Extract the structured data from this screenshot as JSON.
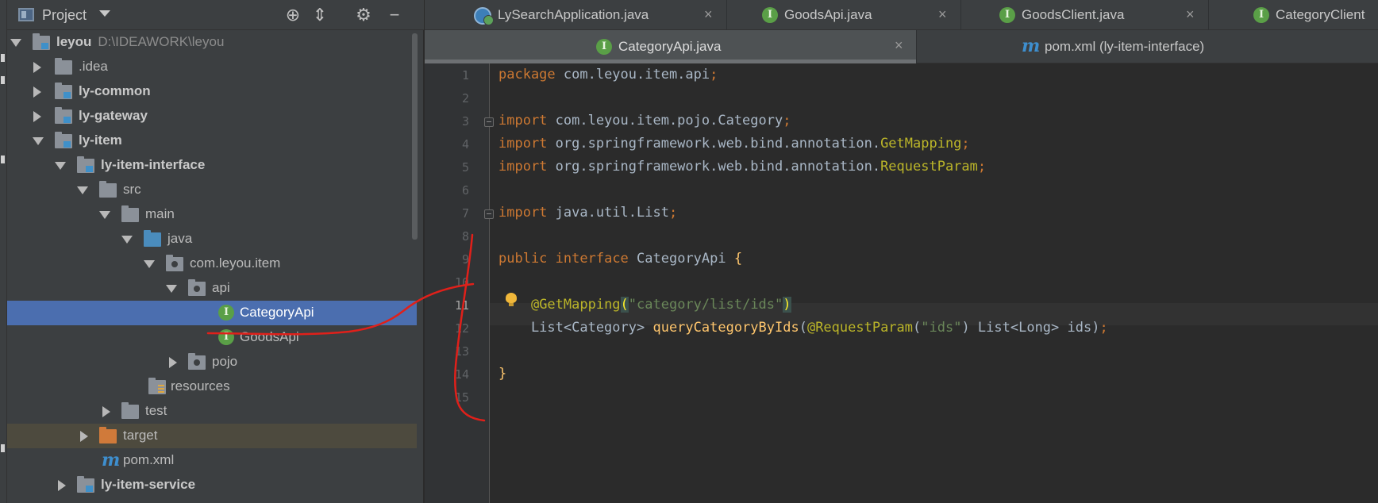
{
  "project_panel": {
    "title": "Project",
    "tree": [
      {
        "label": "leyou",
        "sub": "D:\\IDEAWORK\\leyou",
        "icon": "module-folder-icon",
        "expanded": true
      },
      {
        "label": ".idea",
        "icon": "folder-icon",
        "expanded": false
      },
      {
        "label": "ly-common",
        "icon": "module-folder-icon",
        "expanded": false
      },
      {
        "label": "ly-gateway",
        "icon": "module-folder-icon",
        "expanded": false
      },
      {
        "label": "ly-item",
        "icon": "module-folder-icon",
        "expanded": true
      },
      {
        "label": "ly-item-interface",
        "icon": "module-folder-icon",
        "expanded": true
      },
      {
        "label": "src",
        "icon": "folder-icon",
        "expanded": true
      },
      {
        "label": "main",
        "icon": "folder-icon",
        "expanded": true
      },
      {
        "label": "java",
        "icon": "source-folder-icon",
        "expanded": true
      },
      {
        "label": "com.leyou.item",
        "icon": "package-icon",
        "expanded": true
      },
      {
        "label": "api",
        "icon": "package-icon",
        "expanded": true
      },
      {
        "label": "CategoryApi",
        "icon": "interface-icon",
        "selected": true
      },
      {
        "label": "GoodsApi",
        "icon": "interface-icon"
      },
      {
        "label": "pojo",
        "icon": "package-icon",
        "expanded": false
      },
      {
        "label": "resources",
        "icon": "resources-folder-icon"
      },
      {
        "label": "test",
        "icon": "folder-icon",
        "expanded": false
      },
      {
        "label": "target",
        "icon": "excluded-folder-icon",
        "expanded": false
      },
      {
        "label": "pom.xml",
        "icon": "maven-icon"
      },
      {
        "label": "ly-item-service",
        "icon": "module-folder-icon",
        "expanded": false
      }
    ]
  },
  "tabs_row1": [
    {
      "label": "LySearchApplication.java",
      "icon": "spring-boot-icon"
    },
    {
      "label": "GoodsApi.java",
      "icon": "interface-icon"
    },
    {
      "label": "GoodsClient.java",
      "icon": "interface-icon"
    },
    {
      "label": "CategoryClient",
      "icon": "interface-icon"
    }
  ],
  "tabs_row2": [
    {
      "label": "CategoryApi.java",
      "icon": "interface-icon",
      "active": true
    },
    {
      "label": "pom.xml (ly-item-interface)",
      "icon": "maven-icon"
    }
  ],
  "icons": {
    "interface_letter": "I",
    "maven_letter": "m",
    "close": "×"
  },
  "editor": {
    "line_numbers": [
      "1",
      "2",
      "3",
      "4",
      "5",
      "6",
      "7",
      "8",
      "9",
      "10",
      "11",
      "12",
      "13",
      "14",
      "15"
    ],
    "current_line": 11,
    "lines": [
      "package com.leyou.item.api;",
      "",
      "import com.leyou.item.pojo.Category;",
      "import org.springframework.web.bind.annotation.GetMapping;",
      "import org.springframework.web.bind.annotation.RequestParam;",
      "",
      "import java.util.List;",
      "",
      "public interface CategoryApi {",
      "",
      "    @GetMapping(\"category/list/ids\")",
      "    List<Category> queryCategoryByIds(@RequestParam(\"ids\") List<Long> ids);",
      "",
      "}",
      ""
    ]
  },
  "colors": {
    "keyword": "#cc7832",
    "annotation": "#bbb529",
    "string": "#6a8759",
    "method": "#ffc66d",
    "selection": "#4b6eaf",
    "annotation_stroke": "#e0201a"
  }
}
